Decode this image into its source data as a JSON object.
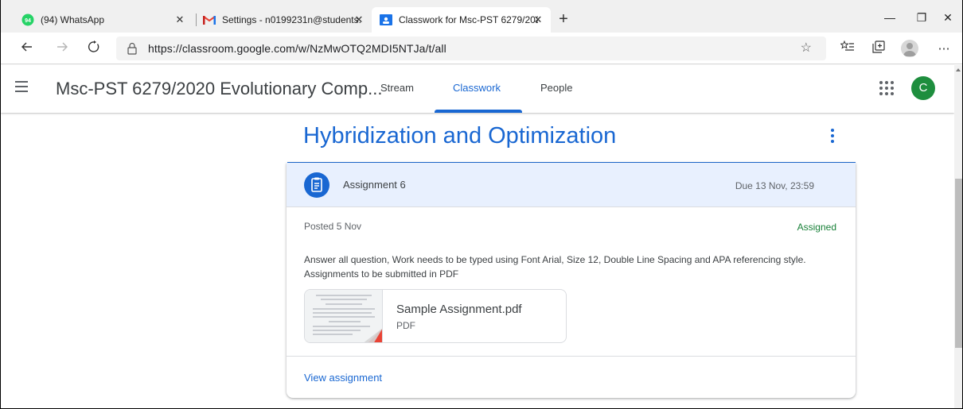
{
  "browser": {
    "tabs": [
      {
        "label": "(94) WhatsApp",
        "icon": "whatsapp-icon",
        "badge": "94",
        "close": "✕"
      },
      {
        "label": "Settings - n0199231n@students.",
        "icon": "gmail-icon",
        "close": "✕"
      },
      {
        "label": "Classwork for Msc-PST 6279/202",
        "icon": "classroom-icon",
        "close": "✕"
      }
    ],
    "new_tab": "+",
    "window": {
      "minimize": "—",
      "restore": "❐",
      "close": "✕"
    },
    "url": "https://classroom.google.com/w/NzMwOTQ2MDI5NTJa/t/all"
  },
  "header": {
    "class_title": "Msc-PST 6279/2020 Evolutionary Comp...",
    "nav": [
      {
        "label": "Stream",
        "active": false
      },
      {
        "label": "Classwork",
        "active": true
      },
      {
        "label": "People",
        "active": false
      }
    ],
    "avatar_letter": "C"
  },
  "topic": {
    "title": "Hybridization and Optimization"
  },
  "assignment": {
    "title": "Assignment 6",
    "due": "Due 13 Nov, 23:59",
    "posted": "Posted 5 Nov",
    "status": "Assigned",
    "description": "Answer all question, Work needs to be typed using Font Arial, Size 12, Double Line Spacing and APA referencing style. Assignments to be submitted in PDF",
    "attachment": {
      "name": "Sample Assignment.pdf",
      "type": "PDF"
    },
    "view_link": "View assignment"
  },
  "colors": {
    "accent": "#1967d2",
    "assigned": "#188038",
    "avatar": "#1e8e3e",
    "header_highlight": "#e8f0fe"
  }
}
